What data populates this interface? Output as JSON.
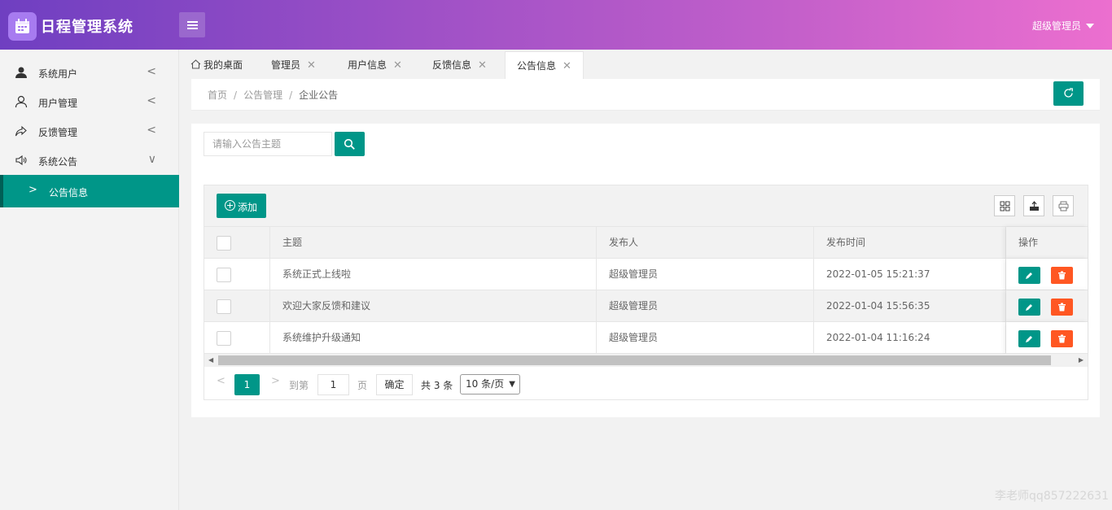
{
  "header": {
    "app_title": "日程管理系统",
    "user_label": "超级管理员"
  },
  "sidebar": {
    "items": [
      {
        "label": "系统用户",
        "icon": "user-solid-icon",
        "arrow": "<"
      },
      {
        "label": "用户管理",
        "icon": "user-outline-icon",
        "arrow": "<"
      },
      {
        "label": "反馈管理",
        "icon": "share-icon",
        "arrow": "<"
      },
      {
        "label": "系统公告",
        "icon": "speaker-icon",
        "arrow": "∨"
      }
    ],
    "sub_item": {
      "label": "公告信息",
      "chevron": ">"
    }
  },
  "tabs": [
    {
      "label": "我的桌面",
      "closable": false
    },
    {
      "label": "管理员",
      "closable": true
    },
    {
      "label": "用户信息",
      "closable": true
    },
    {
      "label": "反馈信息",
      "closable": true
    },
    {
      "label": "公告信息",
      "closable": true,
      "active": true
    }
  ],
  "breadcrumb": {
    "items": [
      "首页",
      "公告管理",
      "企业公告"
    ],
    "separator": "/"
  },
  "search": {
    "placeholder": "请输入公告主题",
    "value": ""
  },
  "toolbar": {
    "add_label": "添加",
    "tool_icons": [
      "columns-icon",
      "export-icon",
      "print-icon"
    ]
  },
  "table": {
    "columns": [
      "主题",
      "发布人",
      "发布时间",
      "操作"
    ],
    "rows": [
      {
        "title": "系统正式上线啦",
        "publisher": "超级管理员",
        "time": "2022-01-05 15:21:37"
      },
      {
        "title": "欢迎大家反馈和建议",
        "publisher": "超级管理员",
        "time": "2022-01-04 15:56:35"
      },
      {
        "title": "系统维护升级通知",
        "publisher": "超级管理员",
        "time": "2022-01-04 11:16:24"
      }
    ]
  },
  "pager": {
    "prev": "<",
    "current": "1",
    "next": ">",
    "goto_label": "到第",
    "goto_value": "1",
    "page_label": "页",
    "confirm_label": "确定",
    "total_label": "共 3 条",
    "page_size": "10 条/页"
  },
  "watermark": "李老师qq857222631",
  "colors": {
    "primary": "#009688",
    "danger": "#ff5722",
    "header_start": "#6f3fc1",
    "header_end": "#ec6fcf"
  }
}
